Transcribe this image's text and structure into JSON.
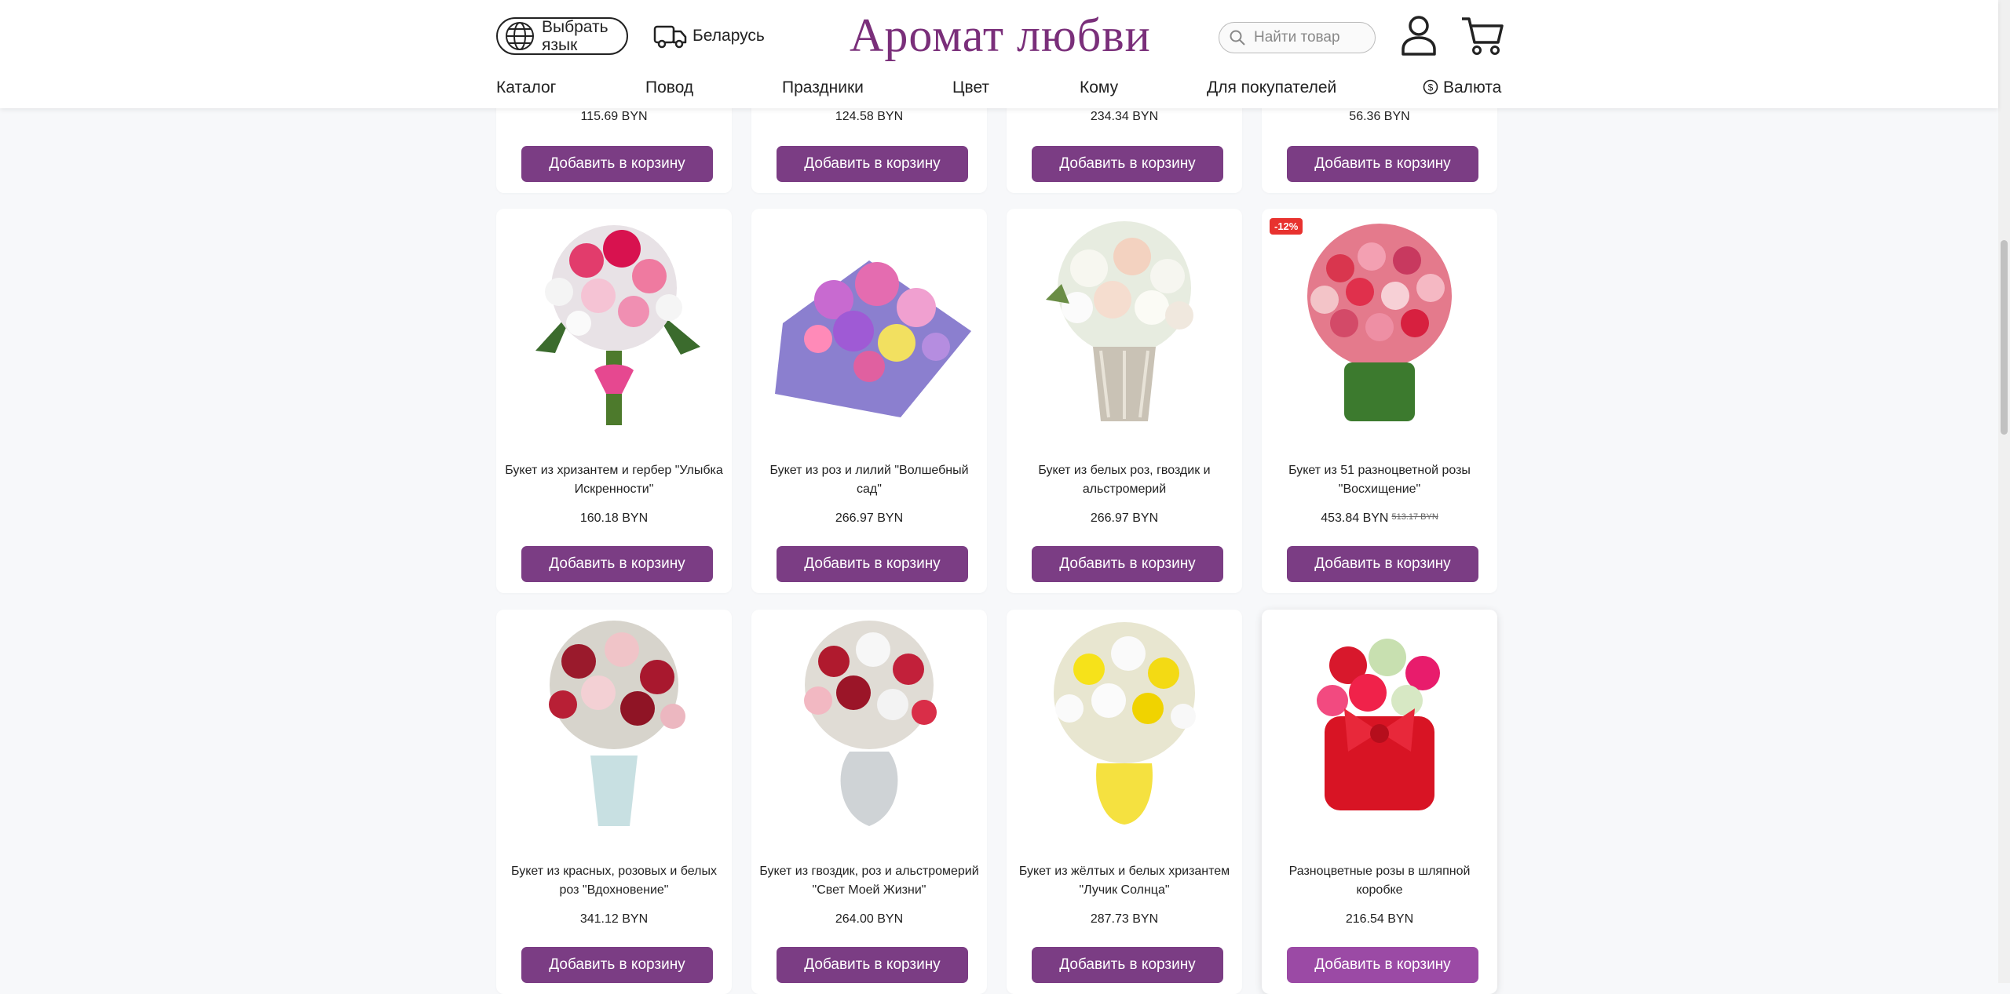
{
  "header": {
    "lang_button": "Выбрать язык",
    "region": "Беларусь",
    "logo": "Аромат любви",
    "search_placeholder": "Найти товар"
  },
  "nav": [
    {
      "label": "Каталог"
    },
    {
      "label": "Повод"
    },
    {
      "label": "Праздники"
    },
    {
      "label": "Цвет"
    },
    {
      "label": "Кому"
    },
    {
      "label": "Для покупателей"
    },
    {
      "label": "Валюта"
    }
  ],
  "add_label": "Добавить в корзину",
  "top_row": [
    {
      "price": "115.69 BYN"
    },
    {
      "price": "124.58 BYN"
    },
    {
      "price": "234.34 BYN"
    },
    {
      "price": "56.36 BYN"
    }
  ],
  "products": [
    {
      "title": "Букет из хризантем и гербер \"Улыбка Искренности\"",
      "price": "160.18 BYN"
    },
    {
      "title": "Букет из роз и лилий \"Волшебный сад\"",
      "price": "266.97 BYN"
    },
    {
      "title": "Букет из белых роз, гвоздик и альстромерий",
      "price": "266.97 BYN"
    },
    {
      "title": "Букет из 51 разноцветной розы \"Восхищение\"",
      "price": "453.84 BYN",
      "old_price": "513.17 BYN",
      "badge": "-12%"
    },
    {
      "title": "Букет из красных, розовых и белых роз \"Вдохновение\"",
      "price": "341.12 BYN"
    },
    {
      "title": "Букет из гвоздик, роз и альстромерий \"Свет Моей Жизни\"",
      "price": "264.00 BYN"
    },
    {
      "title": "Букет из жёлтых и белых хризантем \"Лучик Солнца\"",
      "price": "287.73 BYN"
    },
    {
      "title": "Разноцветные розы в шляпной коробке",
      "price": "216.54 BYN"
    }
  ],
  "colors": {
    "accent": "#7b3d84",
    "logo": "#7a2f7a",
    "badge": "#e8322f"
  }
}
